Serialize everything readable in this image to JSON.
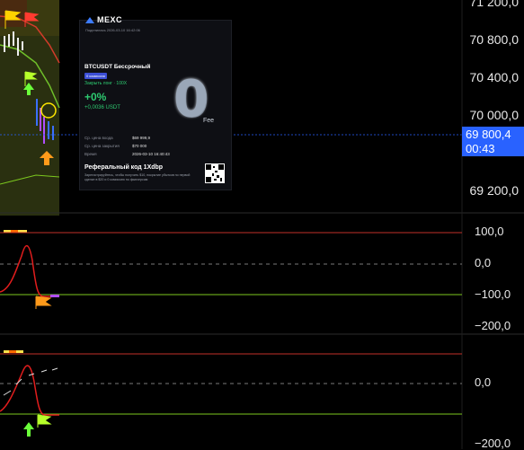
{
  "price_axis": {
    "labels": [
      "71 200,0",
      "70 800,0",
      "70 400,0",
      "70 000,0",
      "69 200,0"
    ],
    "current_price": "69 800,4",
    "countdown": "00:43"
  },
  "card": {
    "brand": "MEXC",
    "shared_at": "Поделилась 2026-03-10 16:42:06",
    "pair": "BTCUSDT Бессрочный",
    "badge": "0 комиссия",
    "close_long": "Закрыть лонг · 100X",
    "pnl_percent": "+0%",
    "pnl_amount": "+0,0036 USDT",
    "big_zero": "0",
    "fee_label": "Fee",
    "rows": [
      {
        "label": "Ср. цена входа",
        "value": "$69 999,9"
      },
      {
        "label": "Ср. цена закрытия",
        "value": "$70 000"
      },
      {
        "label": "Время",
        "value": "2026-03-10 16:40:43"
      }
    ],
    "referral_title": "Реферальный код 1Xdbp",
    "referral_desc": "Зарегистрируйтесь, чтобы получить $10, покрытие убытков по первой сделке в $20 и 0 комиссию по фьючерсам"
  },
  "oscillator1": {
    "labels": [
      "100,0",
      "0,0",
      "−100,0",
      "−200,0"
    ]
  },
  "oscillator2": {
    "labels": [
      "0,0",
      "−200,0"
    ]
  },
  "colors": {
    "accent_blue": "#2962ff",
    "upper_band": "#c2302a",
    "lower_band": "#7cc81e",
    "osc_line": "#e11d1d"
  }
}
